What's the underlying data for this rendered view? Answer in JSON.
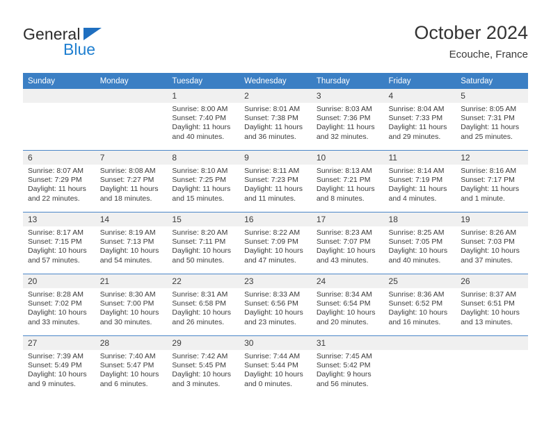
{
  "logo": {
    "word_one": "General",
    "word_two": "Blue",
    "triangle_color": "#1f6fc0",
    "blue_color": "#1f7fd0"
  },
  "header": {
    "title": "October 2024",
    "subtitle": "Ecouche, France"
  },
  "theme": {
    "header_bg": "#3b7fc4",
    "daynum_bg": "#f0f0f0",
    "row_divider": "#4a86c8",
    "text": "#3a3a3a"
  },
  "weekdays": [
    "Sunday",
    "Monday",
    "Tuesday",
    "Wednesday",
    "Thursday",
    "Friday",
    "Saturday"
  ],
  "weeks": [
    [
      {
        "day": "",
        "sunrise": "",
        "sunset": "",
        "daylight_1": "",
        "daylight_2": ""
      },
      {
        "day": "",
        "sunrise": "",
        "sunset": "",
        "daylight_1": "",
        "daylight_2": ""
      },
      {
        "day": "1",
        "sunrise": "Sunrise: 8:00 AM",
        "sunset": "Sunset: 7:40 PM",
        "daylight_1": "Daylight: 11 hours",
        "daylight_2": "and 40 minutes."
      },
      {
        "day": "2",
        "sunrise": "Sunrise: 8:01 AM",
        "sunset": "Sunset: 7:38 PM",
        "daylight_1": "Daylight: 11 hours",
        "daylight_2": "and 36 minutes."
      },
      {
        "day": "3",
        "sunrise": "Sunrise: 8:03 AM",
        "sunset": "Sunset: 7:36 PM",
        "daylight_1": "Daylight: 11 hours",
        "daylight_2": "and 32 minutes."
      },
      {
        "day": "4",
        "sunrise": "Sunrise: 8:04 AM",
        "sunset": "Sunset: 7:33 PM",
        "daylight_1": "Daylight: 11 hours",
        "daylight_2": "and 29 minutes."
      },
      {
        "day": "5",
        "sunrise": "Sunrise: 8:05 AM",
        "sunset": "Sunset: 7:31 PM",
        "daylight_1": "Daylight: 11 hours",
        "daylight_2": "and 25 minutes."
      }
    ],
    [
      {
        "day": "6",
        "sunrise": "Sunrise: 8:07 AM",
        "sunset": "Sunset: 7:29 PM",
        "daylight_1": "Daylight: 11 hours",
        "daylight_2": "and 22 minutes."
      },
      {
        "day": "7",
        "sunrise": "Sunrise: 8:08 AM",
        "sunset": "Sunset: 7:27 PM",
        "daylight_1": "Daylight: 11 hours",
        "daylight_2": "and 18 minutes."
      },
      {
        "day": "8",
        "sunrise": "Sunrise: 8:10 AM",
        "sunset": "Sunset: 7:25 PM",
        "daylight_1": "Daylight: 11 hours",
        "daylight_2": "and 15 minutes."
      },
      {
        "day": "9",
        "sunrise": "Sunrise: 8:11 AM",
        "sunset": "Sunset: 7:23 PM",
        "daylight_1": "Daylight: 11 hours",
        "daylight_2": "and 11 minutes."
      },
      {
        "day": "10",
        "sunrise": "Sunrise: 8:13 AM",
        "sunset": "Sunset: 7:21 PM",
        "daylight_1": "Daylight: 11 hours",
        "daylight_2": "and 8 minutes."
      },
      {
        "day": "11",
        "sunrise": "Sunrise: 8:14 AM",
        "sunset": "Sunset: 7:19 PM",
        "daylight_1": "Daylight: 11 hours",
        "daylight_2": "and 4 minutes."
      },
      {
        "day": "12",
        "sunrise": "Sunrise: 8:16 AM",
        "sunset": "Sunset: 7:17 PM",
        "daylight_1": "Daylight: 11 hours",
        "daylight_2": "and 1 minute."
      }
    ],
    [
      {
        "day": "13",
        "sunrise": "Sunrise: 8:17 AM",
        "sunset": "Sunset: 7:15 PM",
        "daylight_1": "Daylight: 10 hours",
        "daylight_2": "and 57 minutes."
      },
      {
        "day": "14",
        "sunrise": "Sunrise: 8:19 AM",
        "sunset": "Sunset: 7:13 PM",
        "daylight_1": "Daylight: 10 hours",
        "daylight_2": "and 54 minutes."
      },
      {
        "day": "15",
        "sunrise": "Sunrise: 8:20 AM",
        "sunset": "Sunset: 7:11 PM",
        "daylight_1": "Daylight: 10 hours",
        "daylight_2": "and 50 minutes."
      },
      {
        "day": "16",
        "sunrise": "Sunrise: 8:22 AM",
        "sunset": "Sunset: 7:09 PM",
        "daylight_1": "Daylight: 10 hours",
        "daylight_2": "and 47 minutes."
      },
      {
        "day": "17",
        "sunrise": "Sunrise: 8:23 AM",
        "sunset": "Sunset: 7:07 PM",
        "daylight_1": "Daylight: 10 hours",
        "daylight_2": "and 43 minutes."
      },
      {
        "day": "18",
        "sunrise": "Sunrise: 8:25 AM",
        "sunset": "Sunset: 7:05 PM",
        "daylight_1": "Daylight: 10 hours",
        "daylight_2": "and 40 minutes."
      },
      {
        "day": "19",
        "sunrise": "Sunrise: 8:26 AM",
        "sunset": "Sunset: 7:03 PM",
        "daylight_1": "Daylight: 10 hours",
        "daylight_2": "and 37 minutes."
      }
    ],
    [
      {
        "day": "20",
        "sunrise": "Sunrise: 8:28 AM",
        "sunset": "Sunset: 7:02 PM",
        "daylight_1": "Daylight: 10 hours",
        "daylight_2": "and 33 minutes."
      },
      {
        "day": "21",
        "sunrise": "Sunrise: 8:30 AM",
        "sunset": "Sunset: 7:00 PM",
        "daylight_1": "Daylight: 10 hours",
        "daylight_2": "and 30 minutes."
      },
      {
        "day": "22",
        "sunrise": "Sunrise: 8:31 AM",
        "sunset": "Sunset: 6:58 PM",
        "daylight_1": "Daylight: 10 hours",
        "daylight_2": "and 26 minutes."
      },
      {
        "day": "23",
        "sunrise": "Sunrise: 8:33 AM",
        "sunset": "Sunset: 6:56 PM",
        "daylight_1": "Daylight: 10 hours",
        "daylight_2": "and 23 minutes."
      },
      {
        "day": "24",
        "sunrise": "Sunrise: 8:34 AM",
        "sunset": "Sunset: 6:54 PM",
        "daylight_1": "Daylight: 10 hours",
        "daylight_2": "and 20 minutes."
      },
      {
        "day": "25",
        "sunrise": "Sunrise: 8:36 AM",
        "sunset": "Sunset: 6:52 PM",
        "daylight_1": "Daylight: 10 hours",
        "daylight_2": "and 16 minutes."
      },
      {
        "day": "26",
        "sunrise": "Sunrise: 8:37 AM",
        "sunset": "Sunset: 6:51 PM",
        "daylight_1": "Daylight: 10 hours",
        "daylight_2": "and 13 minutes."
      }
    ],
    [
      {
        "day": "27",
        "sunrise": "Sunrise: 7:39 AM",
        "sunset": "Sunset: 5:49 PM",
        "daylight_1": "Daylight: 10 hours",
        "daylight_2": "and 9 minutes."
      },
      {
        "day": "28",
        "sunrise": "Sunrise: 7:40 AM",
        "sunset": "Sunset: 5:47 PM",
        "daylight_1": "Daylight: 10 hours",
        "daylight_2": "and 6 minutes."
      },
      {
        "day": "29",
        "sunrise": "Sunrise: 7:42 AM",
        "sunset": "Sunset: 5:45 PM",
        "daylight_1": "Daylight: 10 hours",
        "daylight_2": "and 3 minutes."
      },
      {
        "day": "30",
        "sunrise": "Sunrise: 7:44 AM",
        "sunset": "Sunset: 5:44 PM",
        "daylight_1": "Daylight: 10 hours",
        "daylight_2": "and 0 minutes."
      },
      {
        "day": "31",
        "sunrise": "Sunrise: 7:45 AM",
        "sunset": "Sunset: 5:42 PM",
        "daylight_1": "Daylight: 9 hours",
        "daylight_2": "and 56 minutes."
      },
      {
        "day": "",
        "sunrise": "",
        "sunset": "",
        "daylight_1": "",
        "daylight_2": ""
      },
      {
        "day": "",
        "sunrise": "",
        "sunset": "",
        "daylight_1": "",
        "daylight_2": ""
      }
    ]
  ]
}
